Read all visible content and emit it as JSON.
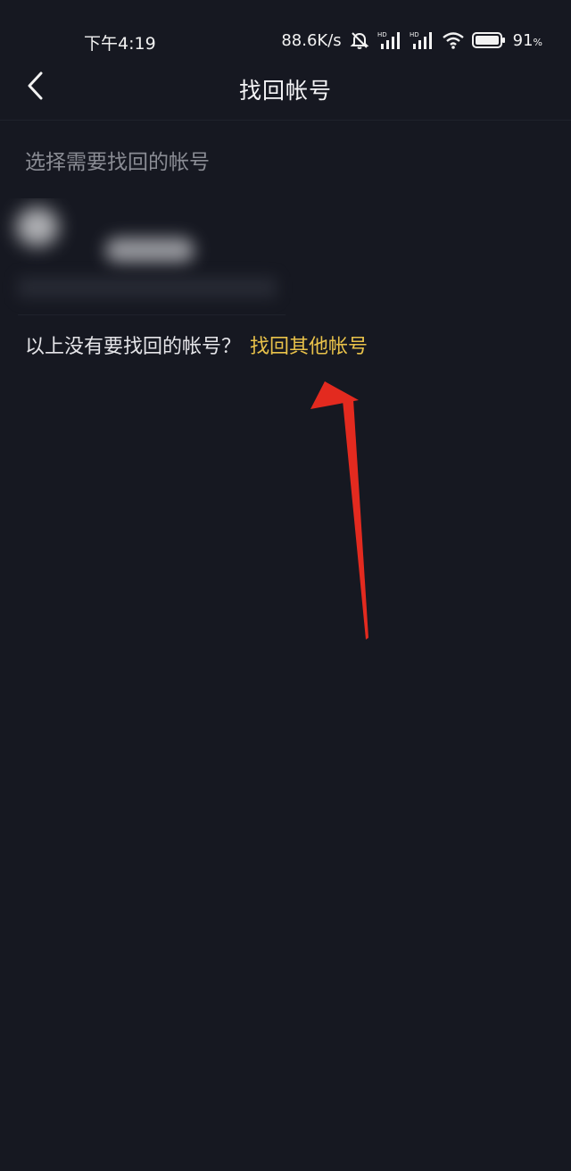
{
  "status_bar": {
    "time": "下午4:19",
    "net_speed": "88.6K/s",
    "battery_percent": "91",
    "battery_unit": "%",
    "hd_label": "HD",
    "icons": [
      "alarm-muted-icon",
      "signal-hd-icon",
      "signal-hd-icon",
      "wifi-icon",
      "battery-icon"
    ]
  },
  "nav": {
    "title": "找回帐号",
    "back_icon": "chevron-left-icon"
  },
  "section_hint": "选择需要找回的帐号",
  "recover": {
    "question": "以上没有要找回的帐号？",
    "link": "找回其他帐号"
  },
  "colors": {
    "background": "#161821",
    "link": "#e9c24a",
    "hint": "#8a8c94",
    "annotation_arrow": "#e32a1f"
  }
}
